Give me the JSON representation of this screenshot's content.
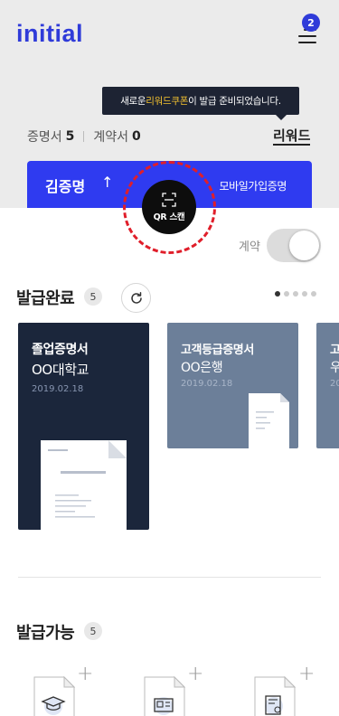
{
  "header": {
    "logo": "initial",
    "menu_badge": "2"
  },
  "tooltip": {
    "before": "새로운 ",
    "highlight": "리워드쿠폰",
    "after": "이 발급 준비되었습니다."
  },
  "counts": {
    "cert_label": "증명서",
    "cert_value": "5",
    "contract_label": "계약서",
    "contract_value": "0",
    "reward_label": "리워드"
  },
  "identity": {
    "name": "김증명",
    "arrow": "↑",
    "mobile_label": "모바일가입증명"
  },
  "qr": {
    "label": "QR 스캔"
  },
  "toggle": {
    "label": "계약",
    "on": true
  },
  "issued": {
    "title": "발급완료",
    "count": "5",
    "cards": [
      {
        "title": "졸업증명서",
        "issuer": "OO대학교",
        "date": "2019.02.18",
        "color": "#1b263b"
      },
      {
        "title": "고객등급증명서",
        "issuer": "OO은행",
        "date": "2019.02.18",
        "color": "#6c7f99"
      },
      {
        "title": "고",
        "issuer": "우",
        "date": "20",
        "color": "#6c7f99"
      }
    ],
    "pages": 5,
    "active_page": 0
  },
  "available": {
    "title": "발급가능",
    "count": "5",
    "items": [
      {
        "icon": "graduation-cap-icon"
      },
      {
        "icon": "id-card-icon"
      },
      {
        "icon": "certificate-icon"
      }
    ]
  },
  "colors": {
    "brand": "#2f3bd9",
    "blue_bar": "#2f3bf0",
    "tooltip_highlight": "#f4c230",
    "qr_ring": "#e01e2a"
  }
}
